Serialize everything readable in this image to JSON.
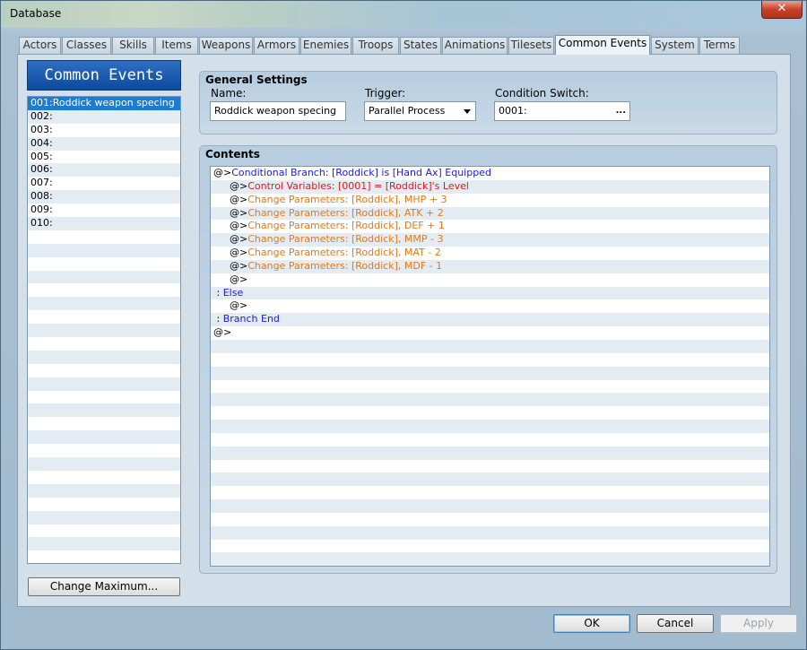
{
  "window": {
    "title": "Database",
    "close_glyph": "✕"
  },
  "tabs": [
    "Actors",
    "Classes",
    "Skills",
    "Items",
    "Weapons",
    "Armors",
    "Enemies",
    "Troops",
    "States",
    "Animations",
    "Tilesets",
    "Common Events",
    "System",
    "Terms"
  ],
  "active_tab": "Common Events",
  "left_panel": {
    "header": "Common Events",
    "items": [
      "001:Roddick weapon specing",
      "002:",
      "003:",
      "004:",
      "005:",
      "006:",
      "007:",
      "008:",
      "009:",
      "010:"
    ],
    "selected_index": 0,
    "change_max_label": "Change Maximum..."
  },
  "general": {
    "title": "General Settings",
    "name_label": "Name:",
    "name_value": "Roddick weapon specing",
    "trigger_label": "Trigger:",
    "trigger_value": "Parallel Process",
    "switch_label": "Condition Switch:",
    "switch_value": "0001:",
    "switch_button": "..."
  },
  "contents": {
    "title": "Contents",
    "lines": [
      {
        "prefix": "@>",
        "text": "Conditional Branch: [Roddick] is [Hand Ax] Equipped",
        "color": "blue",
        "indent": 0
      },
      {
        "prefix": "@>",
        "text": "Control Variables: [0001] = [Roddick]'s Level",
        "color": "red",
        "indent": 1
      },
      {
        "prefix": "@>",
        "text": "Change Parameters: [Roddick], MHP + 3",
        "color": "orange",
        "indent": 1
      },
      {
        "prefix": "@>",
        "text": "Change Parameters: [Roddick], ATK + 2",
        "color": "orange",
        "indent": 1
      },
      {
        "prefix": "@>",
        "text": "Change Parameters: [Roddick], DEF + 1",
        "color": "orange",
        "indent": 1
      },
      {
        "prefix": "@>",
        "text": "Change Parameters: [Roddick], MMP - 3",
        "color": "orange",
        "indent": 1
      },
      {
        "prefix": "@>",
        "text": "Change Parameters: [Roddick], MAT - 2",
        "color": "orange",
        "indent": 1
      },
      {
        "prefix": "@>",
        "text": "Change Parameters: [Roddick], MDF - 1",
        "color": "orange",
        "indent": 1
      },
      {
        "prefix": "@>",
        "text": "",
        "color": "black",
        "indent": 1
      },
      {
        "prefix": " : ",
        "text": "Else",
        "color": "blue",
        "indent": 0
      },
      {
        "prefix": "@>",
        "text": "",
        "color": "black",
        "indent": 1
      },
      {
        "prefix": " : ",
        "text": "Branch End",
        "color": "blue",
        "indent": 0
      },
      {
        "prefix": "@>",
        "text": "",
        "color": "black",
        "indent": 0
      }
    ]
  },
  "buttons": {
    "ok": "OK",
    "cancel": "Cancel",
    "apply": "Apply"
  },
  "colors": {
    "blue": "#1a1adc",
    "red": "#e0181a",
    "orange": "#e07a1c",
    "selection": "#1e7bd0",
    "header": "#0b4aa0"
  }
}
